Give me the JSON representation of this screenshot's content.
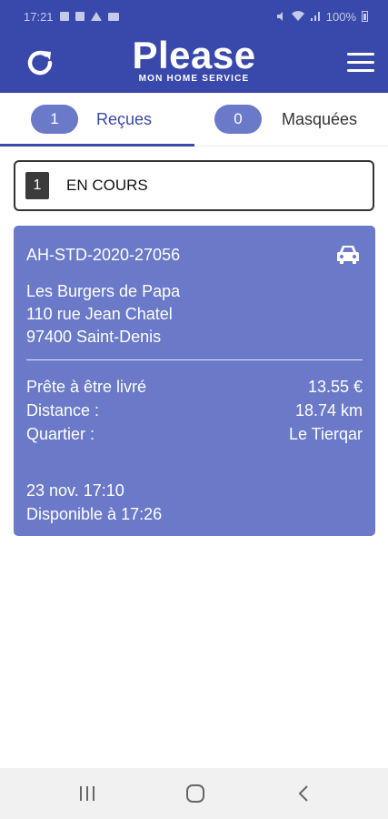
{
  "status_bar": {
    "time": "17:21",
    "battery": "100%"
  },
  "app_bar": {
    "logo_title": "Please",
    "logo_subtitle": "MON HOME SERVICE",
    "refresh_icon": "refresh-icon",
    "menu_icon": "hamburger-menu-icon"
  },
  "tabs": [
    {
      "count": "1",
      "label": "Reçues",
      "active": true
    },
    {
      "count": "0",
      "label": "Masquées",
      "active": false
    }
  ],
  "status_filter": {
    "count": "1",
    "label": "EN COURS"
  },
  "order": {
    "reference": "AH-STD-2020-27056",
    "vehicle_icon": "car-icon",
    "restaurant": "Les Burgers de Papa",
    "street": "110 rue Jean Chatel",
    "city": "97400 Saint-Denis",
    "status_label": "Prête à être livré",
    "price": "13.55 €",
    "distance_label": "Distance :",
    "distance_value": "18.74 km",
    "quarter_label": "Quartier :",
    "quarter_value": "Le Tierqar",
    "date_time": "23 nov. 17:10",
    "available": "Disponible à 17:26"
  },
  "colors": {
    "primary": "#3949ab",
    "card": "#6b79c9",
    "badge": "#3b3b3b"
  }
}
